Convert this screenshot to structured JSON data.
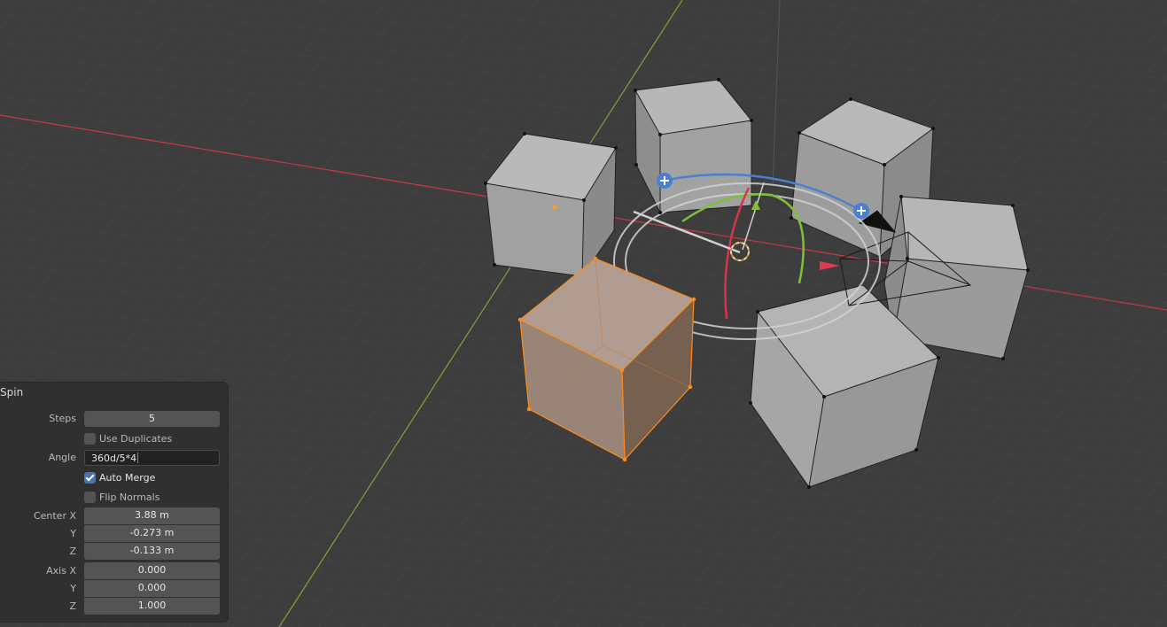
{
  "panel": {
    "title": "Spin",
    "steps": {
      "label": "Steps",
      "value": "5"
    },
    "use_duplicates": {
      "label": "Use Duplicates",
      "checked": false
    },
    "angle": {
      "label": "Angle",
      "value": "360d/5*4"
    },
    "auto_merge": {
      "label": "Auto Merge",
      "checked": true
    },
    "flip_normals": {
      "label": "Flip Normals",
      "checked": false
    },
    "center": {
      "label_x": "Center X",
      "label_y": "Y",
      "label_z": "Z",
      "x": "3.88 m",
      "y": "-0.273 m",
      "z": "-0.133 m"
    },
    "axis": {
      "label_x": "Axis X",
      "label_y": "Y",
      "label_z": "Z",
      "x": "0.000",
      "y": "0.000",
      "z": "1.000"
    }
  },
  "viewport": {
    "background": "#3d3d3d",
    "x_axis_color": "#c7394a",
    "y_axis_color": "#7aa82e",
    "selection_color": "#ff8c1a",
    "gizmo_blue": "#4b7fd1"
  }
}
